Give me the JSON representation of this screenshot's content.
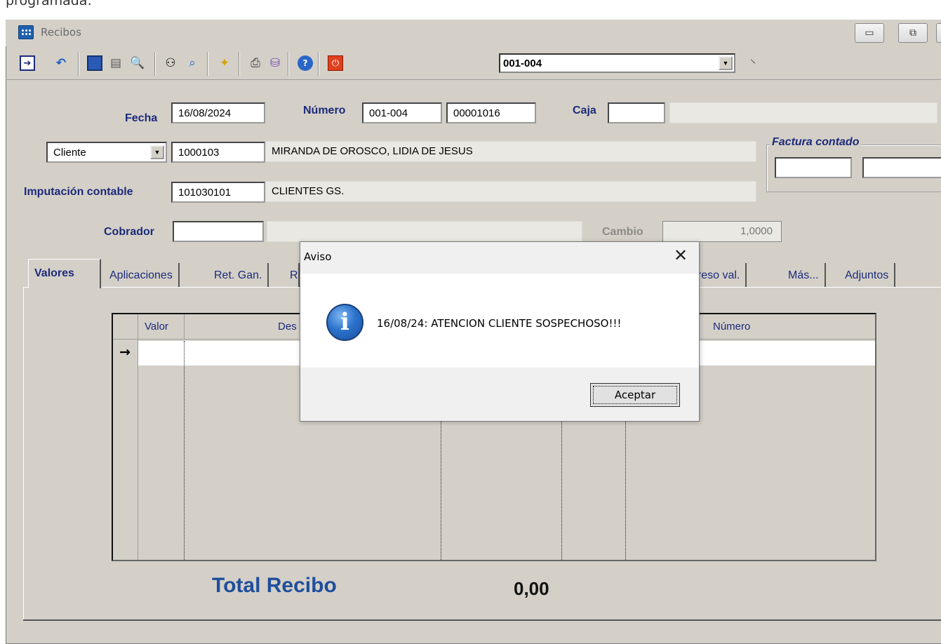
{
  "caption_top": "programada:",
  "window": {
    "title": "Recibos",
    "minimize": "▭",
    "maximize": "⧉"
  },
  "toolbar": {
    "combo_value": "001-004"
  },
  "form": {
    "fecha_label": "Fecha",
    "fecha_value": "16/08/2024",
    "numero_label": "Número",
    "numero_serie": "001-004",
    "numero_value": "00001016",
    "caja_label": "Caja",
    "caja_value": "",
    "tipo_select": "Cliente",
    "cliente_code": "1000103",
    "cliente_name": "MIRANDA DE OROSCO, LIDIA DE JESUS",
    "imputacion_label": "Imputación contable",
    "imputacion_code": "101030101",
    "imputacion_name": "CLIENTES GS.",
    "cobrador_label": "Cobrador",
    "cobrador_value": "",
    "cambio_label": "Cambio",
    "cambio_value": "1,0000",
    "factura_contado_label": "Factura contado"
  },
  "tabs": [
    "Valores",
    "Aplicaciones",
    "Ret. Gan.",
    "R",
    "greso val.",
    "Más...",
    "Adjuntos"
  ],
  "grid": {
    "headers": [
      "Valor",
      "Des",
      "Número"
    ],
    "row_marker": "→"
  },
  "totals": {
    "label": "Total Recibo",
    "value": "0,00"
  },
  "dialog": {
    "title": "Aviso",
    "message": "16/08/24:  ATENCION CLIENTE SOSPECHOSO!!!",
    "ok_label": "Aceptar",
    "icon": "info-icon"
  }
}
